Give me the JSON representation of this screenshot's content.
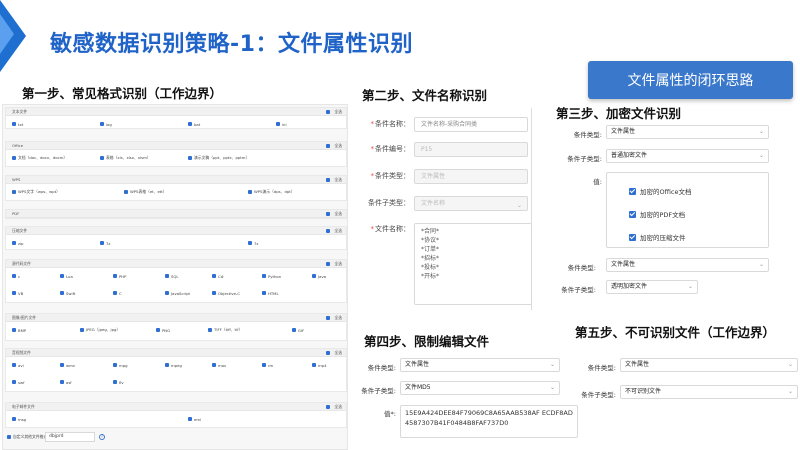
{
  "slide": {
    "title": "敏感数据识别策略-1：文件属性识别",
    "callout": "文件属性的闭环思路",
    "accent_color": "#1f63c8"
  },
  "steps": {
    "step1": "第一步、常见格式识别（工作边界）",
    "step2": "第二步、文件名称识别",
    "step3": "第三步、加密文件识别",
    "step4": "第四步、限制编辑文件",
    "step5": "第五步、不可识别文件（工作边界）"
  },
  "panel1": {
    "select_label": "全选",
    "groups": [
      {
        "name": "文本文件",
        "items": [
          "txt",
          "log",
          "bat",
          "ini"
        ]
      },
      {
        "name": "Office",
        "items": [
          "文档（doc、docx、docm）",
          "表格（xls、xlsx、xlsm）",
          "演示文稿（ppt、pptx、pptm）"
        ]
      },
      {
        "name": "WPS",
        "items": [
          "WPS文字（wps、wpt）",
          "WPS表格（et、ett）",
          "WPS演示（dps、dpt）"
        ]
      },
      {
        "name": "PDF",
        "items": []
      },
      {
        "name": "压缩文件",
        "items": [
          "zip",
          "7z",
          "7z"
        ]
      },
      {
        "name": "源代码文件",
        "items": [
          "c",
          "Lua",
          "PHP",
          "SQL",
          "C#",
          "Python",
          "Java",
          "VB",
          "Swift",
          "C",
          "JavaScript",
          "Objective-C",
          "HTML"
        ]
      },
      {
        "name": "图像/图片文件",
        "items": [
          "BMP",
          "JPEG（jpeg、jpg）",
          "PNG",
          "TIFF（tiff、tif）",
          "GIF"
        ]
      },
      {
        "name": "音视频文件",
        "items": [
          "avi",
          "wmv",
          "mpg",
          "mpeg",
          "mov",
          "rm",
          "mp4",
          "swf",
          "asf",
          "flv"
        ]
      },
      {
        "name": "电子邮件文件",
        "items": [
          "msg",
          "eml"
        ]
      }
    ],
    "custom_label": "自定义其他文件格式",
    "custom_value": "dbjprd"
  },
  "panel2": {
    "rows": [
      {
        "label": "条件名称：",
        "value": "文件名称-采购合同类",
        "required": true
      },
      {
        "label": "条件编号：",
        "value": "P15",
        "required": true
      },
      {
        "label": "条件类型：",
        "value": "文件属性",
        "required": true
      },
      {
        "label": "条件子类型：",
        "value": "文件名称",
        "required": false
      }
    ],
    "filename_label": "文件名称：",
    "filename_values": [
      "*合同*",
      "*协议*",
      "*订单*",
      "*招标*",
      "*投标*",
      "*开标*"
    ]
  },
  "panel3": {
    "type_label": "条件类型:",
    "type_value": "文件属性",
    "subtype_label": "条件子类型:",
    "subtype_value": "普通加密文件",
    "value_label": "值:",
    "options": [
      "加密的Office文档",
      "加密的PDF文档",
      "加密的压缩文件"
    ],
    "type_label2": "条件类型:",
    "type_value2": "文件属性",
    "subtype_label2": "条件子类型:",
    "subtype_value2": "透明加密文件"
  },
  "panel4": {
    "type_label": "条件类型:",
    "type_value": "文件属性",
    "subtype_label": "条件子类型:",
    "subtype_value": "文件MD5",
    "value_label": "值*:",
    "md5": "15E9A424DEE84F79069C8A65AAB538AF ECDF8AD4587307B41F0484B8FAF737D0"
  },
  "panel5": {
    "type_label": "条件类型:",
    "type_value": "文件属性",
    "subtype_label": "条件子类型:",
    "subtype_value": "不可识别文件"
  }
}
